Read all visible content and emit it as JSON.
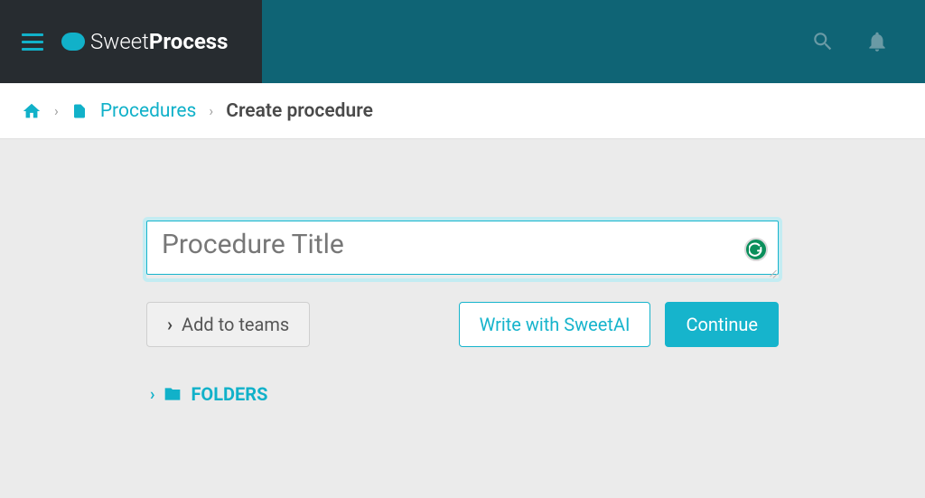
{
  "brand": {
    "light": "Sweet",
    "bold": "Process"
  },
  "breadcrumb": {
    "link": "Procedures",
    "current": "Create procedure"
  },
  "form": {
    "title_placeholder": "Procedure Title",
    "title_value": ""
  },
  "buttons": {
    "add_teams": "Add to teams",
    "sweet_ai": "Write with SweetAI",
    "continue": "Continue"
  },
  "folders": {
    "label": "FOLDERS"
  },
  "colors": {
    "accent": "#11b1c9",
    "header_dark": "#272c30",
    "header_teal": "#0f6475"
  }
}
